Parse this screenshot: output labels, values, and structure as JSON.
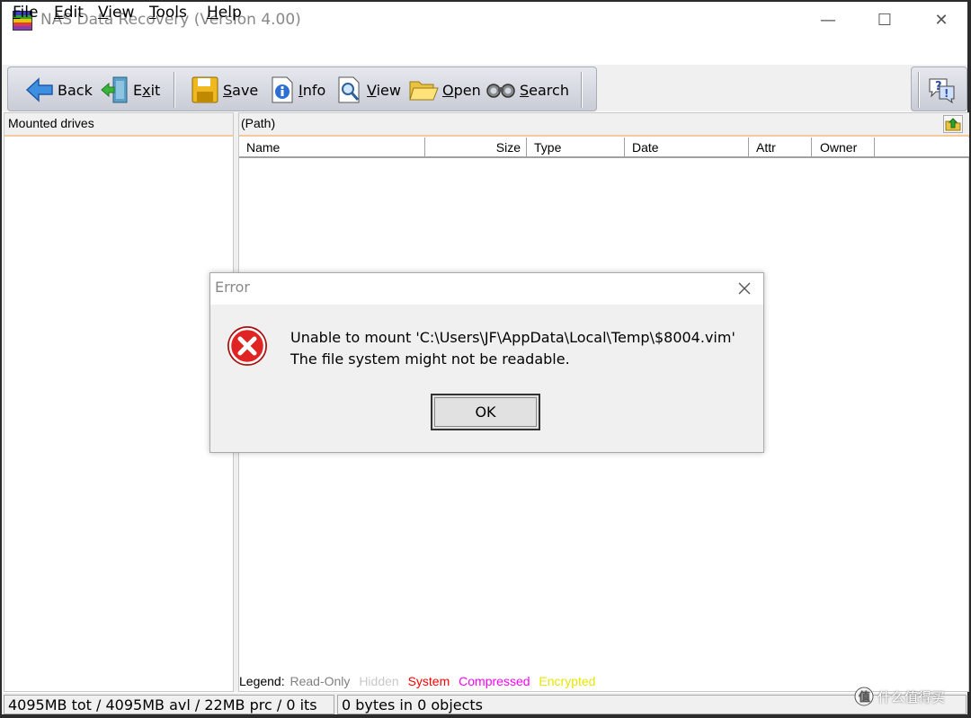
{
  "window": {
    "title": "NAS Data Recovery (Version 4.00)",
    "controls": {
      "minimize": "—",
      "maximize": "☐",
      "close": "✕"
    }
  },
  "menubar": {
    "items": [
      {
        "first": "F",
        "rest": "ile"
      },
      {
        "first": "E",
        "rest": "dit"
      },
      {
        "first": "V",
        "rest": "iew"
      },
      {
        "first": "T",
        "rest": "ools"
      },
      {
        "first": "H",
        "rest": "elp"
      }
    ]
  },
  "toolbar": {
    "back": {
      "label": "Back",
      "icon": "back-arrow-icon"
    },
    "exit": {
      "pre": "E",
      "u": "x",
      "post": "it",
      "icon": "exit-door-icon"
    },
    "save": {
      "u": "S",
      "post": "ave",
      "icon": "floppy-disk-icon"
    },
    "info": {
      "u": "I",
      "post": "nfo",
      "icon": "info-icon"
    },
    "view": {
      "u": "V",
      "post": "iew",
      "icon": "magnifier-page-icon"
    },
    "open": {
      "u": "O",
      "post": "pen",
      "icon": "folder-open-icon"
    },
    "search": {
      "u": "S",
      "post": "earch",
      "icon": "binoculars-icon"
    },
    "help": {
      "icon": "help-question-icon"
    }
  },
  "left_pane": {
    "header": "Mounted drives"
  },
  "right_pane": {
    "path": "(Path)",
    "columns": [
      "Name",
      "Size",
      "Type",
      "Date",
      "Attr",
      "Owner"
    ]
  },
  "legend": {
    "label": "Legend:",
    "items": [
      {
        "text": "Read-Only",
        "color": "#808080"
      },
      {
        "text": "Hidden",
        "color": "#c8c8c8"
      },
      {
        "text": "System",
        "color": "#ff0000"
      },
      {
        "text": "Compressed",
        "color": "#ff00ff"
      },
      {
        "text": "Encrypted",
        "color": "#e6e600"
      }
    ]
  },
  "statusbar": {
    "space": "4095MB tot / 4095MB avl / 22MB prc / 0 its",
    "objects": "0 bytes in 0 objects"
  },
  "watermark": {
    "text": "什么值得买"
  },
  "dialog": {
    "title": "Error",
    "line1": "Unable to mount 'C:\\Users\\JF\\AppData\\Local\\Temp\\$8004.vim'",
    "line2": "The file system might not be readable.",
    "ok_label": "OK",
    "icon": "error-x-icon"
  }
}
